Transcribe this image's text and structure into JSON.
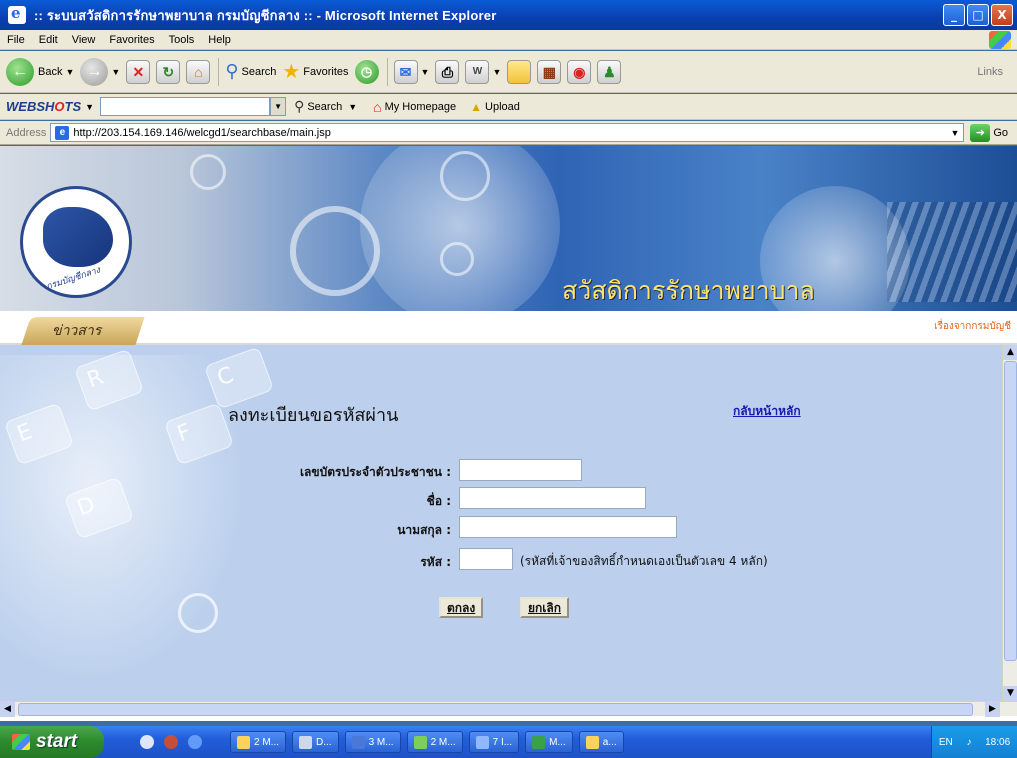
{
  "window": {
    "title": ":: ระบบสวัสดิการรักษาพยาบาล กรมบัญชีกลาง :: - Microsoft Internet Explorer",
    "min_label": "_",
    "max_label": "□",
    "close_label": "X"
  },
  "menubar": {
    "items": [
      "File",
      "Edit",
      "View",
      "Favorites",
      "Tools",
      "Help"
    ]
  },
  "toolbar": {
    "back_label": "Back",
    "search_label": "Search",
    "favorites_label": "Favorites",
    "links_label": "Links"
  },
  "webshots": {
    "logo_prefix": "WEBSH",
    "logo_o": "O",
    "logo_suffix": "TS",
    "search_label": "Search",
    "homepage_label": "My Homepage",
    "upload_label": "Upload"
  },
  "addressbar": {
    "label": "Address",
    "url": "http://203.154.169.146/welcgd1/searchbase/main.jsp",
    "go_label": "Go"
  },
  "page": {
    "banner_title": "สวัสดิการรักษาพยาบาล",
    "seal_text": "กรมบัญชีกลาง",
    "news_tab": "ข่าวสาร",
    "home_link": "เรื่องจากกรมบัญชี",
    "form": {
      "title": "ลงทะเบียนขอรหัสผ่าน",
      "back_link": "กลับหน้าหลัก",
      "fields": [
        {
          "label": "เลขบัตรประจำตัวประชาชน :",
          "value": ""
        },
        {
          "label": "ชื่อ :",
          "value": ""
        },
        {
          "label": "นามสกุล :",
          "value": ""
        },
        {
          "label": "รหัส :",
          "value": ""
        }
      ],
      "code_hint": "(รหัสที่เจ้าของสิทธิ์กำหนดเองเป็นตัวเลข 4 หลัก)",
      "ok_button": "ตกลง",
      "cancel_button": "ยกเลิก"
    }
  },
  "taskbar": {
    "start_label": "start",
    "tasks": [
      "2 M...",
      "D...",
      "3 M...",
      "2 M...",
      "7 I...",
      "M...",
      "a..."
    ],
    "lang": "EN",
    "clock": "18:06"
  }
}
